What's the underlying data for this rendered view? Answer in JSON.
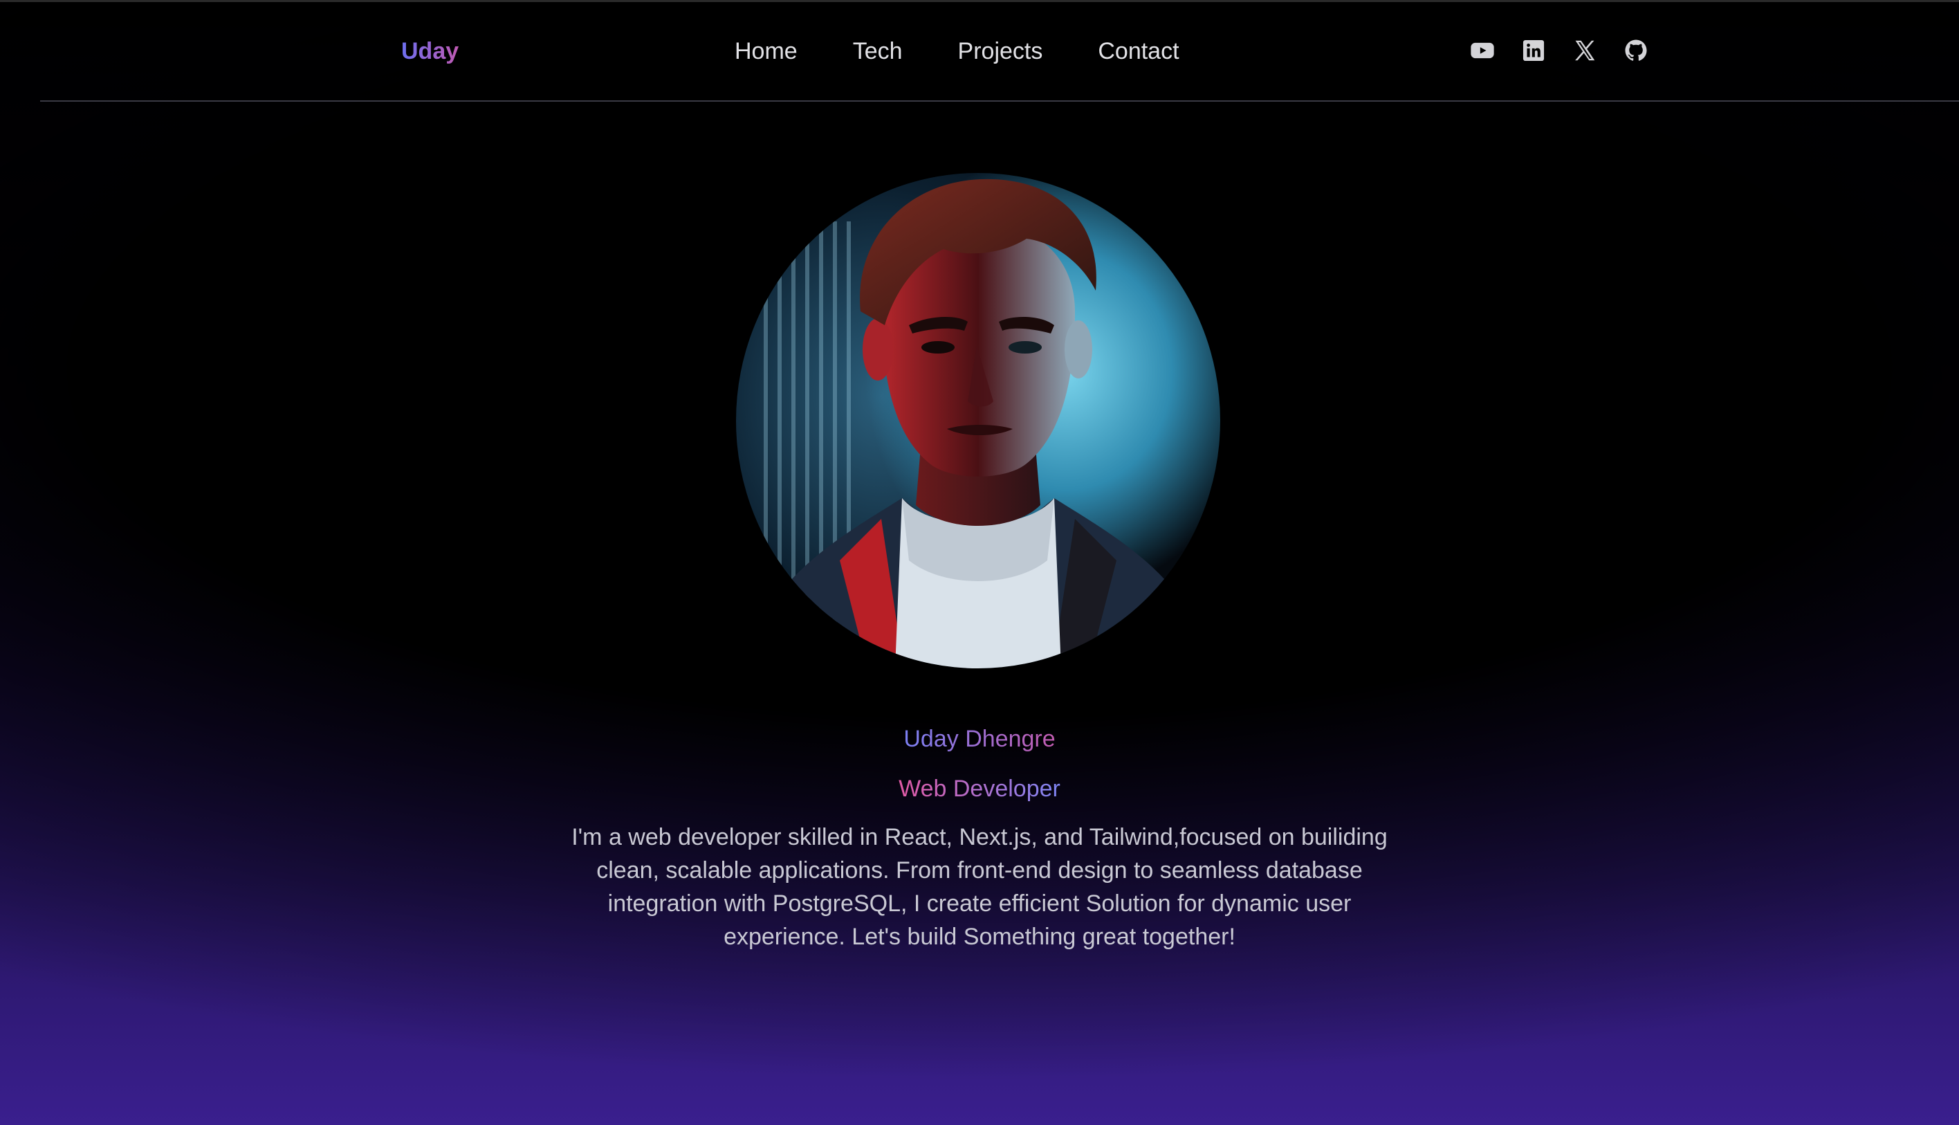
{
  "navbar": {
    "logo": "Uday",
    "links": [
      {
        "label": "Home"
      },
      {
        "label": "Tech"
      },
      {
        "label": "Projects"
      },
      {
        "label": "Contact"
      }
    ],
    "social_icons": [
      "youtube-icon",
      "linkedin-icon",
      "x-icon",
      "github-icon"
    ]
  },
  "hero": {
    "avatar_icon": "profile-portrait",
    "name": "Uday Dhengre",
    "role": "Web Developer",
    "bio": "I'm a web developer skilled in React, Next.js, and Tailwind,focused on builiding clean, scalable applications. From front-end design to seamless database integration with PostgreSQL, I create efficient Solution for dynamic user experience. Let's build Something great together!"
  },
  "colors": {
    "background": "#000000",
    "gradient_bottom": "#3a1f8e",
    "nav_text": "#e2e2e6",
    "bio_text": "#c9c9d4",
    "accent_blue": "#7a7ff2",
    "accent_pink": "#c25cb0"
  }
}
